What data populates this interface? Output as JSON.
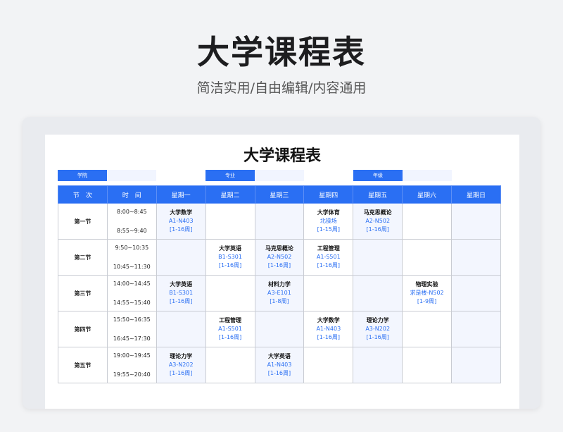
{
  "hero": {
    "title": "大学课程表",
    "subtitle": "简洁实用/自由编辑/内容通用"
  },
  "sheet": {
    "title": "大学课程表",
    "info_labels": [
      "学院",
      "专业",
      "年级"
    ],
    "headers": [
      "节　次",
      "时　间",
      "星期一",
      "星期二",
      "星期三",
      "星期四",
      "星期五",
      "星期六",
      "星期日"
    ],
    "rows": [
      {
        "period": "第一节",
        "t1": "8:00~8:45",
        "t2": "8:55~9:40",
        "cells": [
          {
            "name": "大学数学",
            "room": "A1-N403",
            "weeks": "[1-16周]"
          },
          null,
          null,
          {
            "name": "大学体育",
            "room": "北操场",
            "weeks": "[1-15周]"
          },
          {
            "name": "马克思概论",
            "room": "A2-N502",
            "weeks": "[1-16周]"
          },
          null,
          null
        ]
      },
      {
        "period": "第二节",
        "t1": "9:50~10:35",
        "t2": "10:45~11:30",
        "cells": [
          null,
          {
            "name": "大学英语",
            "room": "B1-S301",
            "weeks": "[1-16周]"
          },
          {
            "name": "马克思概论",
            "room": "A2-N502",
            "weeks": "[1-16周]"
          },
          {
            "name": "工程管理",
            "room": "A1-S501",
            "weeks": "[1-16周]"
          },
          null,
          null,
          null
        ]
      },
      {
        "period": "第三节",
        "t1": "14:00~14:45",
        "t2": "14:55~15:40",
        "cells": [
          {
            "name": "大学英语",
            "room": "B1-S301",
            "weeks": "[1-16周]"
          },
          null,
          {
            "name": "材料力学",
            "room": "A3-E101",
            "weeks": "[1-8周]"
          },
          null,
          null,
          {
            "name": "物理实验",
            "room": "求是楼-N502",
            "weeks": "[1-9周]"
          },
          null
        ]
      },
      {
        "period": "第四节",
        "t1": "15:50~16:35",
        "t2": "16:45~17:30",
        "cells": [
          null,
          {
            "name": "工程管理",
            "room": "A1-S501",
            "weeks": "[1-16周]"
          },
          null,
          {
            "name": "大学数学",
            "room": "A1-N403",
            "weeks": "[1-16周]"
          },
          {
            "name": "理论力学",
            "room": "A3-N202",
            "weeks": "[1-16周]"
          },
          null,
          null
        ]
      },
      {
        "period": "第五节",
        "t1": "19:00~19:45",
        "t2": "19:55~20:40",
        "cells": [
          {
            "name": "理论力学",
            "room": "A3-N202",
            "weeks": "[1-16周]"
          },
          null,
          {
            "name": "大学英语",
            "room": "A1-N403",
            "weeks": "[1-16周]"
          },
          null,
          null,
          null,
          null
        ]
      }
    ]
  }
}
